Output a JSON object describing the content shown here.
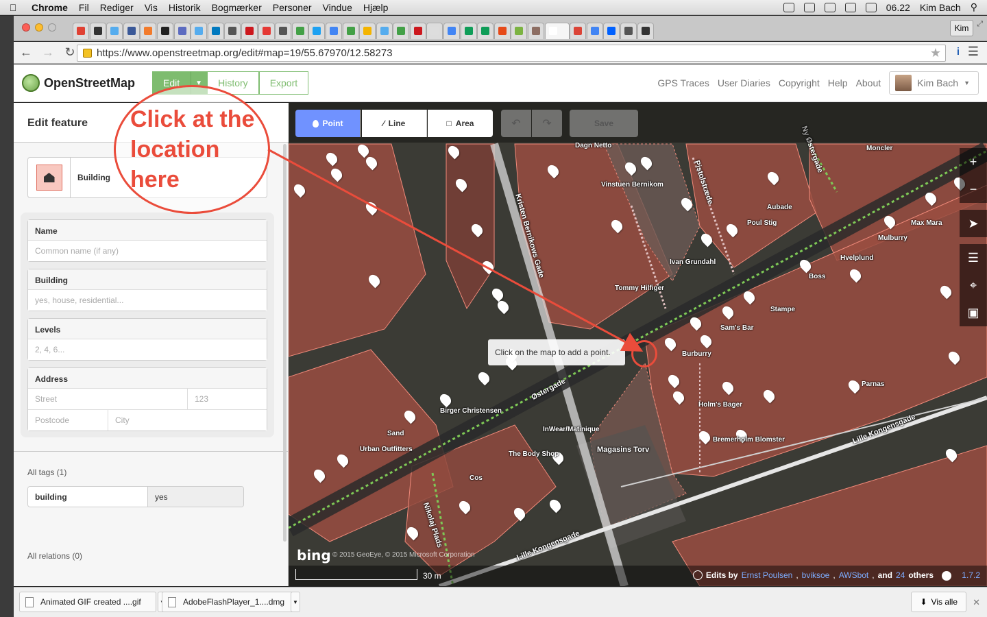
{
  "menubar": {
    "app": "Chrome",
    "items": [
      "Fil",
      "Rediger",
      "Vis",
      "Historik",
      "Bogmærker",
      "Personer",
      "Vindue",
      "Hjælp"
    ],
    "time": "06.22",
    "user": "Kim Bach"
  },
  "browser": {
    "profile": "Kim",
    "url": "https://www.openstreetmap.org/edit#map=19/55.67970/12.58273",
    "tab_colors": [
      "#e04133",
      "#333333",
      "#55acee",
      "#3b5998",
      "#f27b2c",
      "#222222",
      "#5c6bc0",
      "#55acee",
      "#0079bf",
      "#555555",
      "#cc181e",
      "#e53935",
      "#555555",
      "#43a047",
      "#1da1f2",
      "#4285f4",
      "#43a047",
      "#f4b400",
      "#55acee",
      "#43a047",
      "#cc181e",
      "#dddddd",
      "#4285f4",
      "#0f9d58",
      "#0f9d58",
      "#e64a19",
      "#7cb342",
      "#8d6e63",
      "#ffffff",
      "#db4437",
      "#4285f4",
      "#0061ff",
      "#555555",
      "#333333"
    ]
  },
  "osm": {
    "site_name": "OpenStreetMap",
    "edit": "Edit",
    "history": "History",
    "export": "Export",
    "nav": [
      "GPS Traces",
      "User Diaries",
      "Copyright",
      "Help",
      "About"
    ],
    "user": "Kim Bach"
  },
  "sidebar": {
    "title": "Edit feature",
    "preset": "Building",
    "fields": {
      "name_label": "Name",
      "name_placeholder": "Common name (if any)",
      "building_label": "Building",
      "building_placeholder": "yes, house, residential...",
      "levels_label": "Levels",
      "levels_placeholder": "2, 4, 6...",
      "address_label": "Address",
      "street_placeholder": "Street",
      "housenumber_placeholder": "123",
      "postcode_placeholder": "Postcode",
      "city_placeholder": "City"
    },
    "all_tags": "All tags (1)",
    "tag_key": "building",
    "tag_value": "yes",
    "all_relations": "All relations (0)"
  },
  "map": {
    "modes": [
      "Point",
      "Line",
      "Area"
    ],
    "save": "Save",
    "tooltip": "Click on the map to add a point.",
    "scale": "30 m",
    "bing": "bing",
    "imagery": "© 2015 GeoEye, © 2015 Microsoft Corporation",
    "edits_by": "Edits by",
    "editors": [
      "Ernst Poulsen",
      "bviksoe",
      "AWSbot"
    ],
    "and": "and",
    "others_count": "24",
    "others": "others",
    "version": "1.7.2",
    "streets": [
      "Kristen Bernikows Gade",
      "Pistolstræde",
      "Ny Østergade",
      "Østergade",
      "Nikolaj Plads",
      "Lille Kongensgade",
      "Magasins Torv"
    ],
    "pois": [
      "Dagn Netto",
      "Vinstuen Bernikom",
      "Moncler",
      "Aubade",
      "Poul Stig",
      "Max Mara",
      "Mulburry",
      "Ivan Grundahl",
      "Hvelplund",
      "Boss",
      "Tommy Hilfiger",
      "Stampe",
      "Sam's Bar",
      "Burburry",
      "Parnas",
      "Holm's Bager",
      "Bremerholm Blomster",
      "Birger Christensen",
      "Sand",
      "Urban Outfitters",
      "InWear/Matinique",
      "The Body Shop",
      "Cos"
    ]
  },
  "annotation": {
    "text": "Click at the location here",
    "color": "#ea4c3b"
  },
  "downloads": {
    "items": [
      "Animated GIF created ....gif",
      "AdobeFlashPlayer_1....dmg"
    ],
    "show_all": "Vis alle"
  }
}
